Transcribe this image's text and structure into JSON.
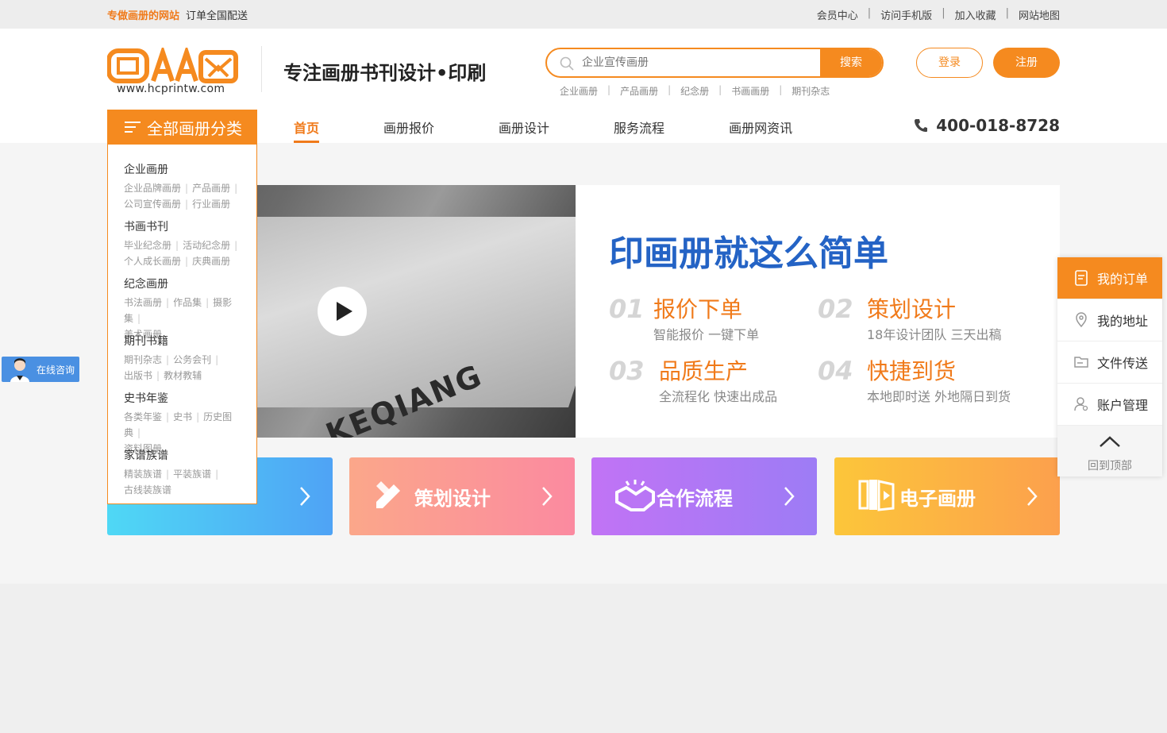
{
  "topbar": {
    "brand": "专做画册的网站",
    "tagline": "订单全国配送",
    "links": [
      "会员中心",
      "访问手机版",
      "加入收藏",
      "网站地图"
    ],
    "separator": "|"
  },
  "logo": {
    "url_text": "www.hcprintw.com"
  },
  "slogan": "专注画册书刊设计•印刷",
  "search": {
    "placeholder": "企业宣传画册",
    "button": "搜索",
    "hotwords": [
      "企业画册",
      "产品画册",
      "纪念册",
      "书画画册",
      "期刊杂志"
    ]
  },
  "auth": {
    "login": "登录",
    "register": "注册"
  },
  "nav": [
    "首页",
    "画册报价",
    "画册设计",
    "服务流程",
    "画册网资讯"
  ],
  "phone": "400-018-8728",
  "category": {
    "title": "全部画册分类",
    "groups": [
      {
        "title": "企业画册",
        "items": [
          "企业品牌画册",
          "产品画册",
          "公司宣传画册",
          "行业画册"
        ]
      },
      {
        "title": "书画书刊",
        "items": [
          "毕业纪念册",
          "活动纪念册",
          "个人成长画册",
          "庆典画册"
        ]
      },
      {
        "title": "纪念画册",
        "items": [
          "书法画册",
          "作品集",
          "摄影集",
          "美术画册"
        ]
      },
      {
        "title": "期刊书籍",
        "items": [
          "期刊杂志",
          "公务会刊",
          "出版书",
          "教材教辅"
        ]
      },
      {
        "title": "史书年鉴",
        "items": [
          "各类年鉴",
          "史书",
          "历史图典",
          "资料图册"
        ]
      },
      {
        "title": "家谱族谱",
        "items": [
          "精装族谱",
          "平装族谱",
          "古线装族谱"
        ]
      }
    ]
  },
  "video": {
    "brand_text": "KEQIANG"
  },
  "promo": {
    "title": "印画册就这么简单",
    "steps": [
      {
        "num": "01",
        "name": "报价下单",
        "desc": "智能报价 一键下单"
      },
      {
        "num": "02",
        "name": "策划设计",
        "desc": "18年设计团队 三天出稿"
      },
      {
        "num": "03",
        "name": "品质生产",
        "desc": "全流程化 快速出成品"
      },
      {
        "num": "04",
        "name": "快捷到货",
        "desc": "本地即时送 外地隔日到货"
      }
    ]
  },
  "cards": [
    {
      "label": "",
      "color_from": "#4fd8f5",
      "color_to": "#4fa3f5"
    },
    {
      "label": "策划设计",
      "color_from": "#fba78a",
      "color_to": "#fb8aa0"
    },
    {
      "label": "合作流程",
      "color_from": "#c173f5",
      "color_to": "#9d7cf5"
    },
    {
      "label": "电子画册",
      "color_from": "#fcc63a",
      "color_to": "#fca04d"
    }
  ],
  "sidebar": {
    "items": [
      "我的订单",
      "我的地址",
      "文件传送",
      "账户管理"
    ],
    "back_top": "回到顶部"
  },
  "consult": "在线咨询",
  "colors": {
    "accent": "#f58a1f",
    "blue": "#2463c5"
  }
}
